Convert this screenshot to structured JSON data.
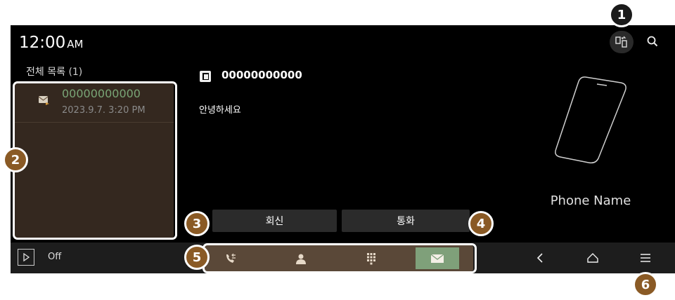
{
  "status": {
    "time": "12:00",
    "ampm": "AM"
  },
  "list": {
    "title": "전체 목록",
    "count": "(1)",
    "items": [
      {
        "number": "00000000000",
        "date": "2023.9.7. 3:20 PM",
        "icon": "message-icon"
      }
    ]
  },
  "detail": {
    "number": "00000000000",
    "body": "안녕하세요",
    "icon": "message-copy-icon"
  },
  "device": {
    "name": "Phone Name",
    "icon": "phone-outline-icon"
  },
  "actions": {
    "reply_label": "회신",
    "call_label": "통화"
  },
  "bottombar": {
    "play_label": "Off",
    "tabs": [
      {
        "icon": "call-history-icon",
        "active": false
      },
      {
        "icon": "contacts-icon",
        "active": false
      },
      {
        "icon": "dialpad-icon",
        "active": false
      },
      {
        "icon": "messages-icon",
        "active": true
      }
    ],
    "nav_icons": [
      "back-icon",
      "home-icon",
      "menu-icon"
    ]
  },
  "badges": [
    "1",
    "2",
    "3",
    "4",
    "5",
    "6"
  ],
  "colors": {
    "accent_green": "#7fa07a",
    "list_bg": "#34281f",
    "tabs_bg": "#5a4838",
    "badge": "#8a5a25"
  }
}
